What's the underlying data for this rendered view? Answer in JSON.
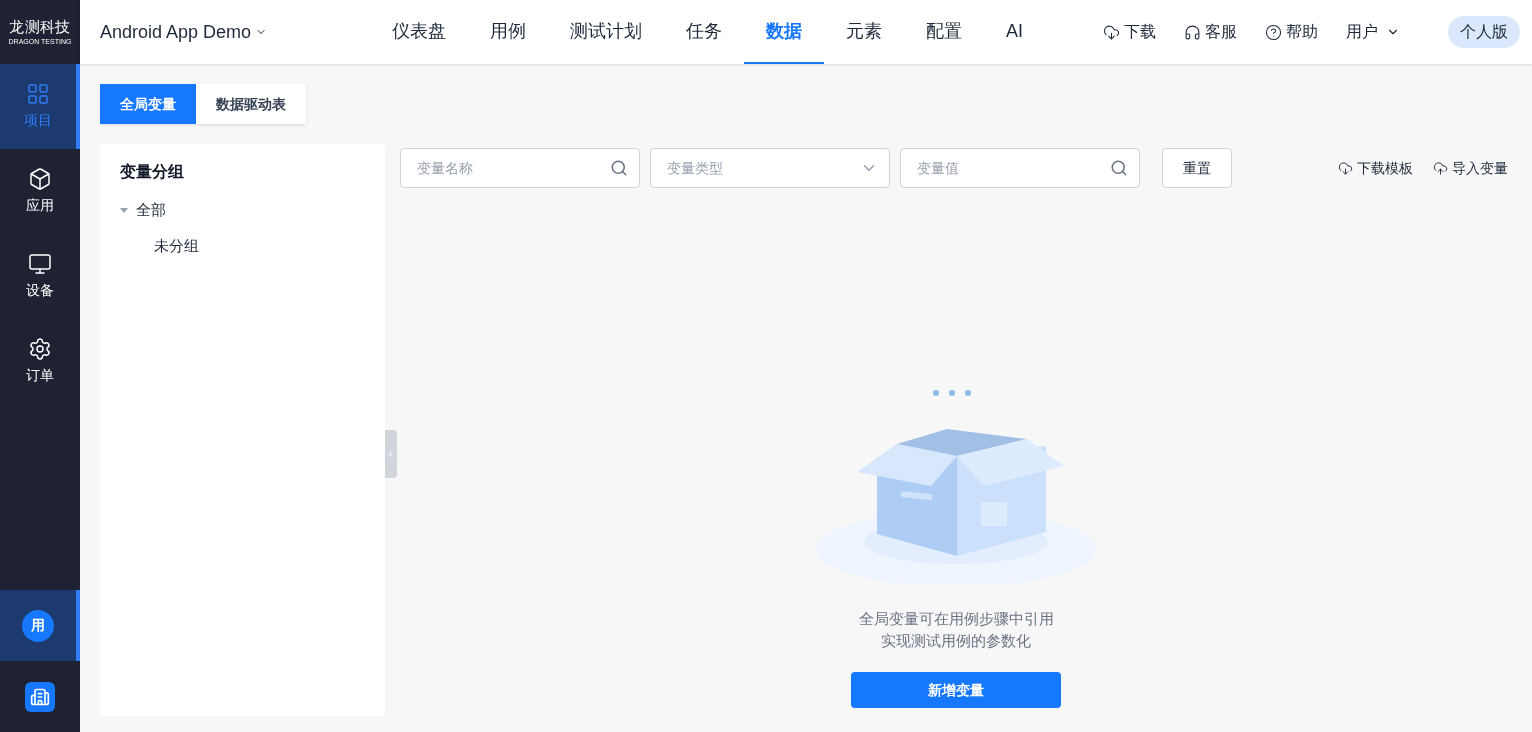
{
  "logo": {
    "title": "龙测科技",
    "subtitle": "DRAGON TESTING"
  },
  "sidebar": {
    "items": [
      {
        "label": "项目",
        "selected": true
      },
      {
        "label": "应用",
        "selected": false
      },
      {
        "label": "设备",
        "selected": false
      },
      {
        "label": "订单",
        "selected": false
      }
    ],
    "bottom": [
      {
        "kind": "avatar",
        "text": "用",
        "selected": true
      },
      {
        "kind": "building",
        "selected": false
      }
    ]
  },
  "header": {
    "project": "Android App Demo",
    "nav": [
      {
        "label": "仪表盘",
        "selected": false
      },
      {
        "label": "用例",
        "selected": false
      },
      {
        "label": "测试计划",
        "selected": false
      },
      {
        "label": "任务",
        "selected": false
      },
      {
        "label": "数据",
        "selected": true
      },
      {
        "label": "元素",
        "selected": false
      },
      {
        "label": "配置",
        "selected": false
      },
      {
        "label": "AI",
        "selected": false
      }
    ],
    "actions": [
      {
        "label": "下载"
      },
      {
        "label": "客服"
      },
      {
        "label": "帮助"
      }
    ],
    "user": "用户",
    "edition": "个人版"
  },
  "tabs": [
    {
      "label": "全局变量",
      "selected": true
    },
    {
      "label": "数据驱动表",
      "selected": false
    }
  ],
  "groups": {
    "title": "变量分组",
    "tree": [
      {
        "label": "全部",
        "expanded": true,
        "children": [
          {
            "label": "未分组"
          }
        ]
      }
    ]
  },
  "filters": [
    {
      "kind": "search",
      "placeholder": "变量名称"
    },
    {
      "kind": "select",
      "placeholder": "变量类型"
    },
    {
      "kind": "search",
      "placeholder": "变量值"
    }
  ],
  "reset": "重置",
  "links": [
    {
      "label": "下载模板"
    },
    {
      "label": "导入变量"
    }
  ],
  "empty": {
    "lines": [
      "全局变量可在用例步骤中引用",
      "实现测试用例的参数化"
    ],
    "button": "新增变量"
  }
}
